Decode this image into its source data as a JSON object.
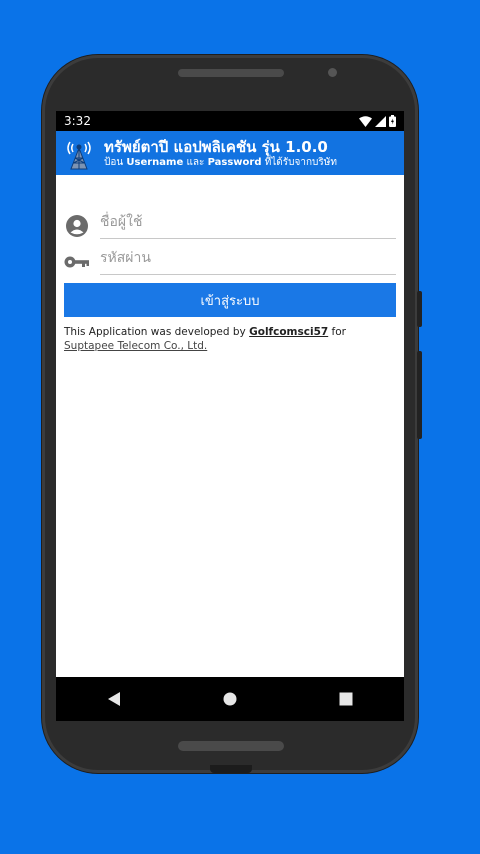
{
  "status_bar": {
    "time": "3:32",
    "icons": [
      "wifi-icon",
      "signal-icon",
      "battery-icon"
    ]
  },
  "app_bar": {
    "title": "ทรัพย์ตาปี แอปพลิเคชัน รุ่น 1.0.0",
    "subtitle_prefix": "ป้อน",
    "subtitle_username": "Username",
    "subtitle_and": "และ",
    "subtitle_password": "Password",
    "subtitle_suffix": "ที่ได้รับจากบริษัท",
    "logo_icon": "tower-logo-icon"
  },
  "form": {
    "username_placeholder": "ชื่อผู้ใช้",
    "username_value": "",
    "username_icon": "account-circle-icon",
    "password_placeholder": "รหัสผ่าน",
    "password_value": "",
    "password_icon": "key-icon",
    "login_label": "เข้าสู่ระบบ"
  },
  "credit": {
    "prefix": "This Application was developed by",
    "developer": "Golfcomsci57",
    "for": "for",
    "company": "Suptapee Telecom Co., Ltd."
  },
  "nav": {
    "back": "back-icon",
    "home": "home-icon",
    "recents": "recents-icon"
  },
  "colors": {
    "background": "#0a73e8",
    "app_bar": "#1273e1",
    "button": "#1a78e6"
  }
}
